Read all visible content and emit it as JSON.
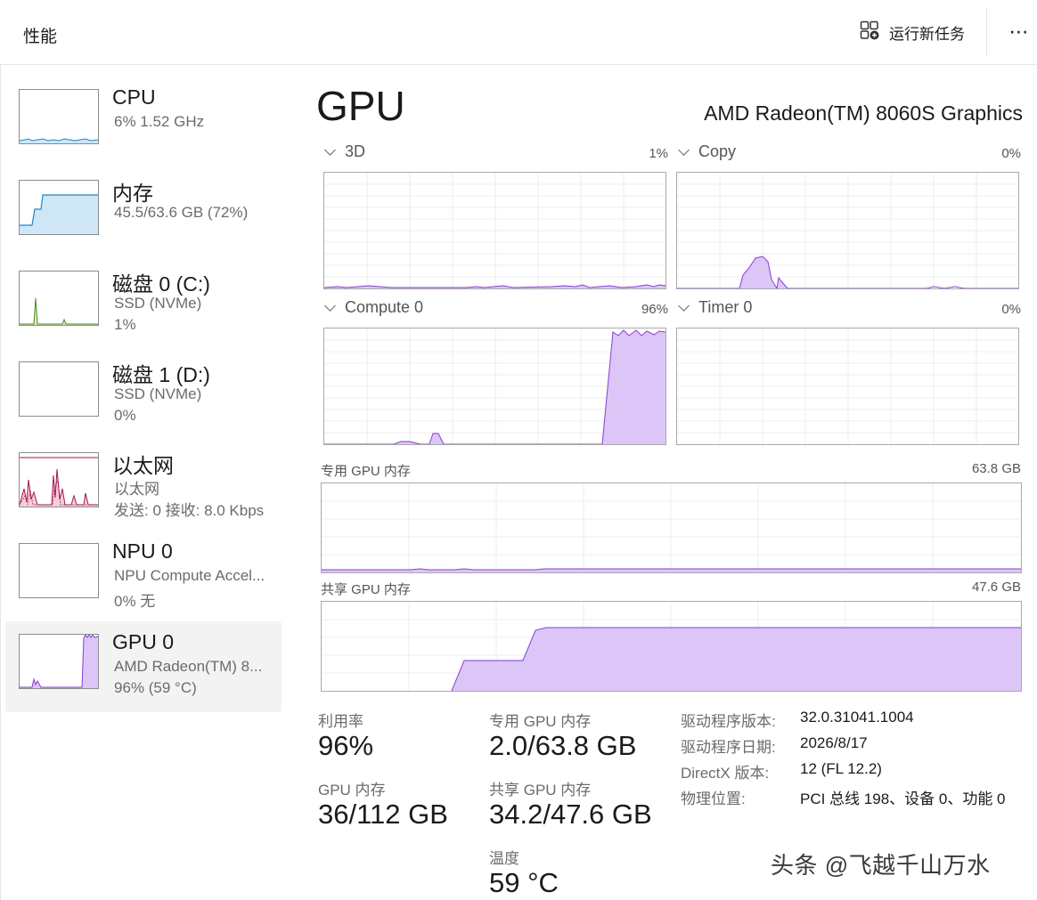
{
  "header": {
    "title": "性能",
    "run_new_task": "运行新任务",
    "more": "⋯",
    "run_task_icon": "run-task-icon"
  },
  "sidebar": {
    "items": [
      {
        "name": "CPU",
        "sub": "6%  1.52 GHz",
        "sub2": "",
        "color": "#1a88c9"
      },
      {
        "name": "内存",
        "sub": "45.5/63.6 GB (72%)",
        "sub2": "",
        "color": "#1a88c9"
      },
      {
        "name": "磁盘 0 (C:)",
        "sub": "SSD (NVMe)",
        "sub2": "1%",
        "color": "#4d8a1f"
      },
      {
        "name": "磁盘 1 (D:)",
        "sub": "SSD (NVMe)",
        "sub2": "0%",
        "color": "#4d8a1f"
      },
      {
        "name": "以太网",
        "sub": "以太网",
        "sub2": "发送: 0 接收: 8.0 Kbps",
        "color": "#a7164e"
      },
      {
        "name": "NPU 0",
        "sub": "NPU Compute Accel...",
        "sub2": "0% 无",
        "color": "#1a88c9"
      },
      {
        "name": "GPU 0",
        "sub": "AMD Radeon(TM) 8...",
        "sub2": "96%  (59 °C)",
        "color": "#8a3cd4",
        "selected": true
      }
    ]
  },
  "gpu": {
    "title": "GPU",
    "model": "AMD Radeon(TM) 8060S Graphics",
    "accent": "#8a3cd4",
    "fill": "#dcc6f7",
    "engines": [
      {
        "name": "3D",
        "pct": "1%"
      },
      {
        "name": "Copy",
        "pct": "0%"
      },
      {
        "name": "Compute 0",
        "pct": "96%"
      },
      {
        "name": "Timer 0",
        "pct": "0%"
      }
    ],
    "dedicated_mem": {
      "label": "专用 GPU 内存",
      "max": "63.8 GB"
    },
    "shared_mem": {
      "label": "共享 GPU 内存",
      "max": "47.6 GB"
    }
  },
  "stats": {
    "utilization": {
      "label": "利用率",
      "value": "96%"
    },
    "gpu_memory": {
      "label": "GPU 内存",
      "value": "36/112 GB"
    },
    "dedicated": {
      "label": "专用 GPU 内存",
      "value": "2.0/63.8 GB"
    },
    "shared": {
      "label": "共享 GPU 内存",
      "value": "34.2/47.6 GB"
    },
    "temperature": {
      "label": "温度",
      "value": "59 °C"
    }
  },
  "properties": [
    {
      "label": "驱动程序版本:",
      "value": "32.0.31041.1004"
    },
    {
      "label": "驱动程序日期:",
      "value": "2026/8/17"
    },
    {
      "label": "DirectX 版本:",
      "value": "12 (FL 12.2)"
    },
    {
      "label": "物理位置:",
      "value": "PCI 总线 198、设备 0、功能 0"
    }
  ],
  "watermark": "头条 @飞越千山万水"
}
